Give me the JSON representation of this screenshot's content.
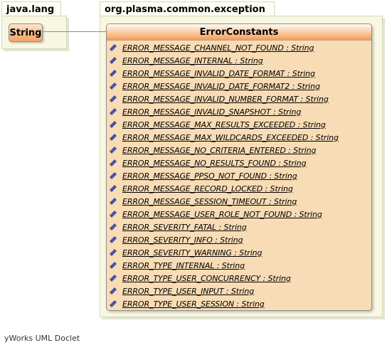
{
  "packages": {
    "java_lang": {
      "name": "java.lang",
      "class_name": "String"
    },
    "exception": {
      "name": "org.plasma.common.exception",
      "class_name": "ErrorConstants",
      "attributes": [
        "ERROR_MESSAGE_CHANNEL_NOT_FOUND : String",
        "ERROR_MESSAGE_INTERNAL : String",
        "ERROR_MESSAGE_INVALID_DATE_FORMAT : String",
        "ERROR_MESSAGE_INVALID_DATE_FORMAT2 : String",
        "ERROR_MESSAGE_INVALID_NUMBER_FORMAT : String",
        "ERROR_MESSAGE_INVALID_SNAPSHOT : String",
        "ERROR_MESSAGE_MAX_RESULTS_EXCEEDED : String",
        "ERROR_MESSAGE_MAX_WILDCARDS_EXCEEDED : String",
        "ERROR_MESSAGE_NO_CRITERIA_ENTERED : String",
        "ERROR_MESSAGE_NO_RESULTS_FOUND : String",
        "ERROR_MESSAGE_PPSO_NOT_FOUND : String",
        "ERROR_MESSAGE_RECORD_LOCKED : String",
        "ERROR_MESSAGE_SESSION_TIMEOUT : String",
        "ERROR_MESSAGE_USER_ROLE_NOT_FOUND : String",
        "ERROR_SEVERITY_FATAL : String",
        "ERROR_SEVERITY_INFO : String",
        "ERROR_SEVERITY_WARNING : String",
        "ERROR_TYPE_INTERNAL : String",
        "ERROR_TYPE_USER_CONCURRENCY : String",
        "ERROR_TYPE_USER_INPUT : String",
        "ERROR_TYPE_USER_SESSION : String"
      ]
    }
  },
  "attribute_icon": "static-field-diamond-icon",
  "colors": {
    "icon": "#4a58b0",
    "header_accent": "#f39c5c",
    "class_fill": "#f8dcb5",
    "package_fill": "#f7f7e2"
  },
  "footer": "yWorks UML Doclet"
}
